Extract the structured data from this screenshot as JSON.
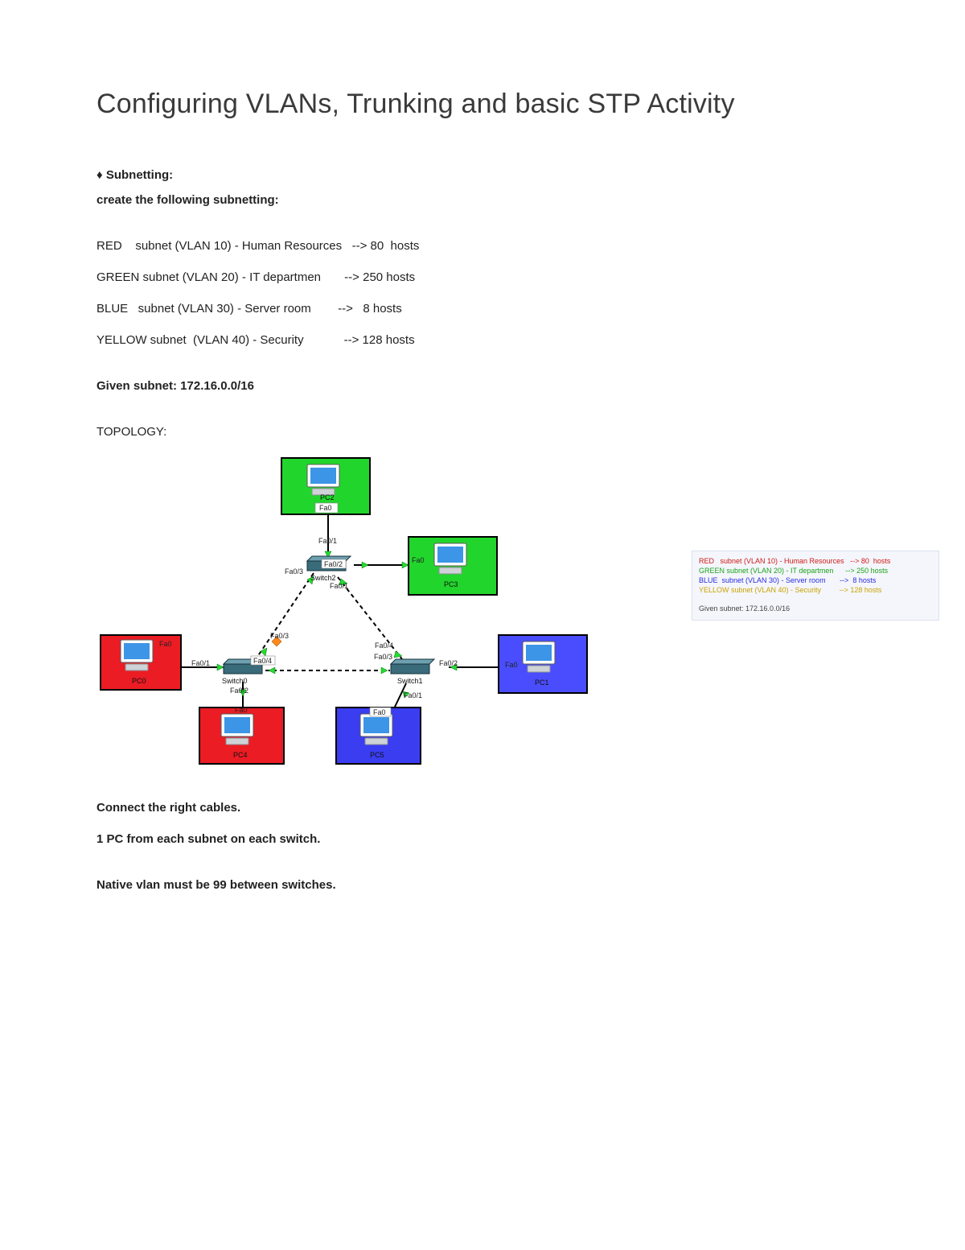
{
  "title": "Configuring VLANs, Trunking and basic STP Activity",
  "section": {
    "subnetting_label": "♦ Subnetting:",
    "create_line": "create the following subnetting:"
  },
  "subnets": {
    "red": "RED    subnet (VLAN 10) - Human Resources   --> 80  hosts",
    "green": "GREEN subnet (VLAN 20) - IT departmen       --> 250 hosts",
    "blue": "BLUE   subnet (VLAN 30) - Server room        -->   8 hosts",
    "yellow": "YELLOW subnet  (VLAN 40) - Security            --> 128 hosts"
  },
  "given_subnet": "Given subnet: 172.16.0.0/16",
  "topology_label": "TOPOLOGY:",
  "instructions": {
    "cables": "Connect the right cables.",
    "one_pc": "1 PC from each subnet on each switch.",
    "native_vlan": "Native vlan must be 99 between switches."
  },
  "diagram": {
    "devices": {
      "pc0": {
        "label": "PC0",
        "port": "Fa0"
      },
      "pc1": {
        "label": "PC1",
        "port": "Fa0"
      },
      "pc2": {
        "label": "PC2",
        "port": "Fa0"
      },
      "pc3": {
        "label": "PC3",
        "port": "Fa0"
      },
      "pc4": {
        "label": "PC4",
        "port": "Fa0"
      },
      "pc5": {
        "label": "PC5",
        "port": "Fa0"
      },
      "sw0": {
        "label": "Switch0"
      },
      "sw1": {
        "label": "Switch1"
      },
      "sw2": {
        "label": "Switch2"
      }
    },
    "ports": {
      "sw2_f01": "Fa0/1",
      "sw2_f02": "Fa0/2",
      "sw2_f03": "Fa0/3",
      "sw2_f01b": "Fa0/1",
      "sw0_f01": "Fa0/1",
      "sw0_f02": "Fa0/2",
      "sw0_f03": "Fa0/3",
      "sw0_f04": "Fa0/4",
      "sw1_f01": "Fa0/1",
      "sw1_f02": "Fa0/2",
      "sw1_f03": "Fa0/3",
      "sw1_f04": "Fa0/4"
    }
  },
  "info_card": {
    "red": "RED   subnet (VLAN 10) - Human Resources   --> 80  hosts",
    "green": "GREEN subnet (VLAN 20) - IT departmen      --> 250 hosts",
    "blue": "BLUE  subnet (VLAN 30) - Server room       -->  8 hosts",
    "yellow": "YELLOW subnet (VLAN 40) - Security         --> 128 hosts",
    "given": "Given subnet: 172.16.0.0/16"
  }
}
